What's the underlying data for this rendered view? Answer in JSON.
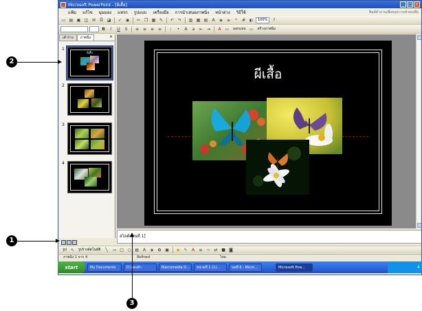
{
  "window": {
    "title": "Microsoft PowerPoint - [ผีเสื้อ]"
  },
  "menu": [
    "แฟ้ม",
    "แก้ไข",
    "มุมมอง",
    "แทรก",
    "รูปแบบ",
    "เครื่องมือ",
    "การนำเสนอภาพนิ่ง",
    "หน้าต่าง",
    "วิธีใช้"
  ],
  "help_box": "พิมพ์คำถามเพื่อขอความช่วยเหลือ",
  "toolbar": {
    "zoom": "100%",
    "bold": "B",
    "italic": "I",
    "underline": "U",
    "shadow": "S",
    "design_label": "ออกแบบ",
    "new_slide_label": "สร้างภาพนิ่ง"
  },
  "pane": {
    "tab_outline": "เค้าร่าง",
    "tab_slides": "ภาพนิ่ง",
    "close": "×"
  },
  "thumbnails": [
    {
      "num": "1",
      "title": "ผีเสื้อ"
    },
    {
      "num": "2",
      "title": ""
    },
    {
      "num": "3",
      "title": ""
    },
    {
      "num": "4",
      "title": ""
    }
  ],
  "slide": {
    "title": "ผีเสื้อ"
  },
  "notes": {
    "placeholder": "สไลด์แผ่นที่ 1]"
  },
  "drawbar": {
    "draw_label": "รูป",
    "autoshapes_label": "รูปร่างอัตโนมัติ"
  },
  "statusbar": {
    "slide_pos": "ภาพนิ่ง 1 จาก 4",
    "design": "Refined",
    "language": "ไทย"
  },
  "taskbar": {
    "start": "start",
    "tasks": [
      "My Documents",
      "D:\\ลองทำ",
      "Macromedia D...",
      "หน่วยที่ 1 (1)...",
      "บทที่ 6 - Micro...",
      "Microsoft Pow..."
    ],
    "clock": "4"
  },
  "callouts": {
    "c1": "1",
    "c2": "2",
    "c3": "3"
  },
  "colors": {
    "slide_bg": "#000000",
    "titlebar": "#1c4fbf",
    "taskbar": "#245edb"
  }
}
